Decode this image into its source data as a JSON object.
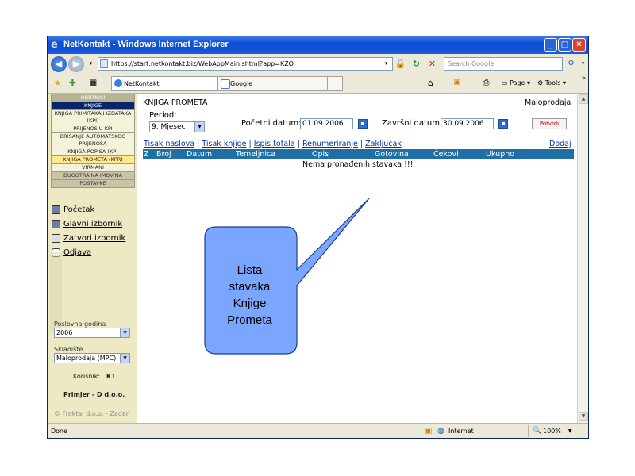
{
  "window": {
    "title": "NetKontakt - Windows Internet Explorer"
  },
  "address": {
    "url": "https://start.netkontakt.biz/WebAppMain.shtml?app=KZO",
    "search_placeholder": "Search Google"
  },
  "tabs": [
    {
      "label": "NetKontakt"
    },
    {
      "label": "Google"
    }
  ],
  "toolbar": {
    "page_label": "Page",
    "tools_label": "Tools"
  },
  "sidebar": {
    "menu": [
      {
        "label": "OBRTNICI",
        "style": "head"
      },
      {
        "label": "KNJIGE",
        "style": "blue"
      },
      {
        "label": "KNJIGA PRIMITAKA I IZDATAKA (KPI)",
        "style": "normal"
      },
      {
        "label": "PRIJENOS U KPI",
        "style": "normal"
      },
      {
        "label": "BRISANJE AUTOMATSKOG PRIJENOSA",
        "style": "normal"
      },
      {
        "label": "KNJIGA POPISA (KP)",
        "style": "normal"
      },
      {
        "label": "KNJIGA PROMETA (KPR)",
        "style": "hl"
      },
      {
        "label": "VIRMANI",
        "style": "normal"
      },
      {
        "label": "DUGOTRAJNA IMOVINA",
        "style": "dark"
      },
      {
        "label": "POSTAVKE",
        "style": "dark"
      }
    ],
    "links": [
      {
        "label": "Početak"
      },
      {
        "label": "Glavni izbornik"
      },
      {
        "label": "Zatvori izbornik"
      },
      {
        "label": "Odjava"
      }
    ],
    "year_label": "Poslovna godina",
    "year_value": "2006",
    "warehouse_label": "Skladište",
    "warehouse_value": "Maloprodaja (MPC)",
    "user_label": "Korisnik:",
    "user_value": "K1",
    "company": "Primjer - D d.o.o.",
    "footer": "© Fraktal d.o.o. - Zadar"
  },
  "main": {
    "title": "KNJIGA PROMETA",
    "store": "Maloprodaja",
    "period_label": "Period:",
    "period_value": "9. Mjesec",
    "start_label": "Početni datum:",
    "start_value": "01.09.2006",
    "end_label": "Završni datum:",
    "end_value": "30.09.2006",
    "confirm_label": "Potvrdi",
    "actions": [
      "Tisak naslova",
      "Tisak knjige",
      "Ispis totala",
      "Renumeriranje",
      "Zaključak"
    ],
    "add_label": "Dodaj",
    "columns": [
      "Z",
      "Broj",
      "Datum",
      "Temeljnica",
      "Opis",
      "Gotovina",
      "Čekovi",
      "Ukupno"
    ],
    "empty_message": "Nema pronađenih stavaka !!!"
  },
  "status": {
    "text": "Done",
    "zone": "Internet",
    "zoom": "100%"
  },
  "callout": {
    "lines": [
      "Lista",
      "stavaka",
      "Knjige",
      "Prometa"
    ]
  }
}
